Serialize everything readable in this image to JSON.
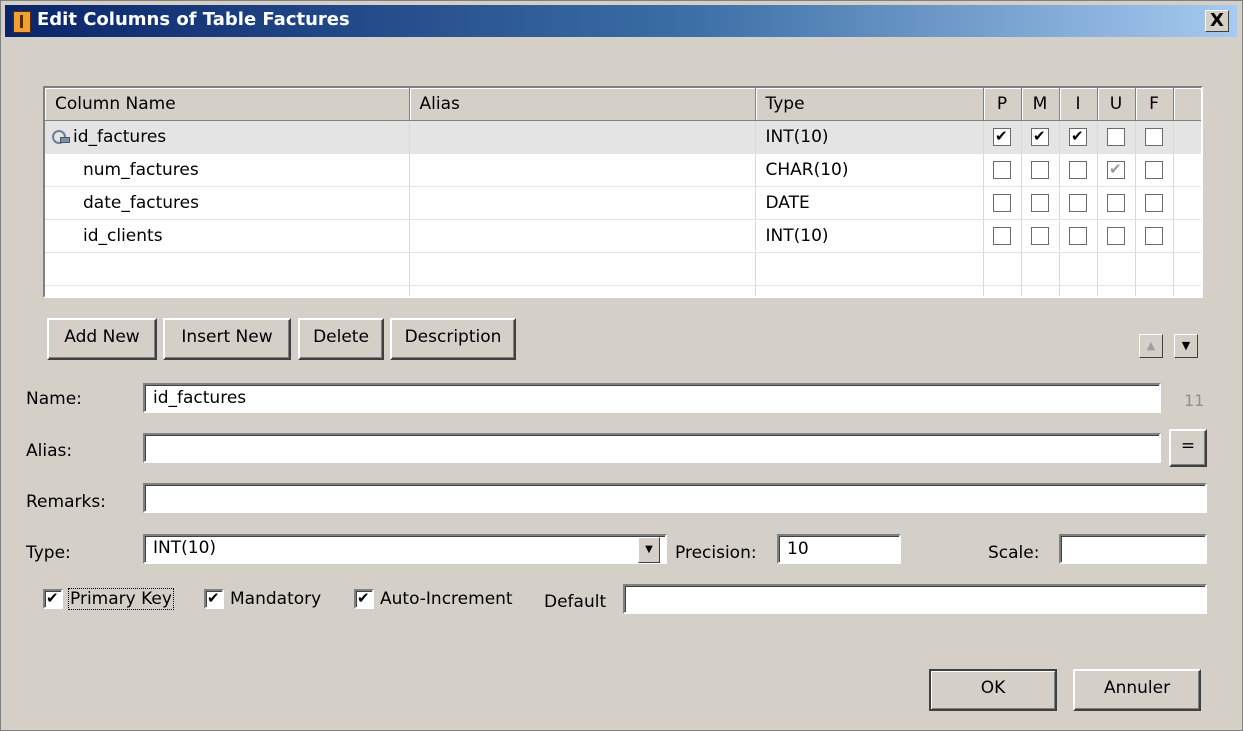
{
  "window": {
    "title": "Edit Columns of Table Factures",
    "close_label": "X"
  },
  "grid": {
    "headers": {
      "column_name": "Column Name",
      "alias": "Alias",
      "type": "Type",
      "p": "P",
      "m": "M",
      "i": "I",
      "u": "U",
      "f": "F"
    },
    "rows": [
      {
        "name": "id_factures",
        "alias": "",
        "type": "INT(10)",
        "p": true,
        "m": true,
        "i": true,
        "u": false,
        "f": false,
        "key": true
      },
      {
        "name": "num_factures",
        "alias": "",
        "type": "CHAR(10)",
        "p": false,
        "m": false,
        "i": false,
        "u": true,
        "f": false,
        "u_gray": true
      },
      {
        "name": "date_factures",
        "alias": "",
        "type": "DATE",
        "p": false,
        "m": false,
        "i": false,
        "u": false,
        "f": false
      },
      {
        "name": "id_clients",
        "alias": "",
        "type": "INT(10)",
        "p": false,
        "m": false,
        "i": false,
        "u": false,
        "f": false
      }
    ]
  },
  "buttons": {
    "add_new": "Add New",
    "insert_new": "Insert New",
    "delete": "Delete",
    "description": "Description",
    "ok": "OK",
    "cancel": "Annuler",
    "alias_equal": "="
  },
  "form": {
    "name_label": "Name:",
    "name_value": "id_factures",
    "name_counter": "11",
    "alias_label": "Alias:",
    "alias_value": "",
    "remarks_label": "Remarks:",
    "remarks_value": "",
    "type_label": "Type:",
    "type_value": "INT(10)",
    "precision_label": "Precision:",
    "precision_value": "10",
    "scale_label": "Scale:",
    "scale_value": "",
    "primary_key_label": "Primary Key",
    "primary_key_checked": true,
    "mandatory_label": "Mandatory",
    "mandatory_checked": true,
    "auto_increment_label": "Auto-Increment",
    "auto_increment_checked": true,
    "default_label": "Default",
    "default_value": ""
  },
  "colors": {
    "dialog_bg": "#d4d0c8",
    "title_start": "#0a246a",
    "title_end": "#a6caf0"
  }
}
